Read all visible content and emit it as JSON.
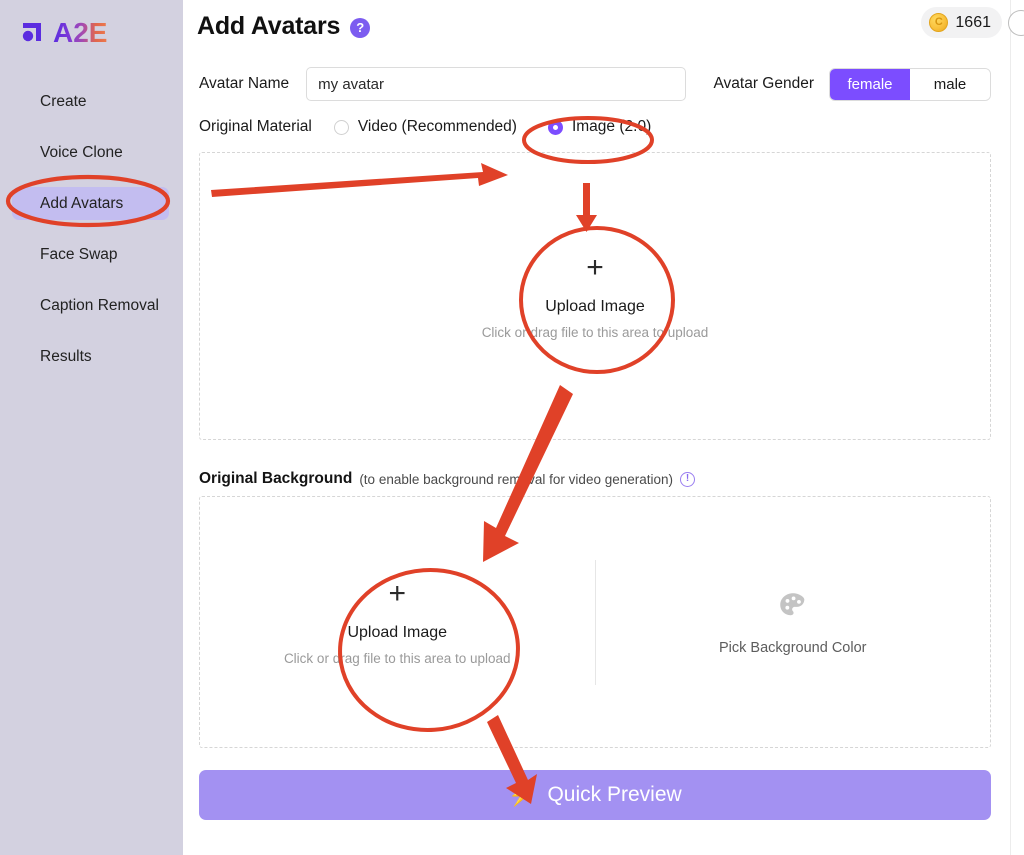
{
  "brand": {
    "logo_text": "A2E",
    "logo_icon": "a2e-mark-icon"
  },
  "sidebar": {
    "items": [
      {
        "label": "Create",
        "active": false
      },
      {
        "label": "Voice Clone",
        "active": false
      },
      {
        "label": "Add Avatars",
        "active": true
      },
      {
        "label": "Face Swap",
        "active": false
      },
      {
        "label": "Caption Removal",
        "active": false
      },
      {
        "label": "Results",
        "active": false
      }
    ]
  },
  "header": {
    "title": "Add Avatars",
    "help_badge": "?",
    "credits": "1661",
    "coin_glyph": "C"
  },
  "form": {
    "avatar_name_label": "Avatar Name",
    "avatar_name_value": "my avatar",
    "avatar_name_placeholder": "my avatar",
    "avatar_gender_label": "Avatar Gender",
    "gender_options": [
      {
        "label": "female",
        "selected": true
      },
      {
        "label": "male",
        "selected": false
      }
    ],
    "original_material_label": "Original Material",
    "material_options": [
      {
        "label": "Video (Recommended)",
        "selected": false
      },
      {
        "label": "Image (2.0)",
        "selected": true
      }
    ]
  },
  "upload_main": {
    "plus": "+",
    "title": "Upload Image",
    "subtitle": "Click or drag file to this area to upload"
  },
  "background_section": {
    "heading_strong": "Original Background",
    "heading_hint": "(to enable background removal for video generation)",
    "info_glyph": "!",
    "upload": {
      "plus": "+",
      "title": "Upload Image",
      "subtitle": "Click or drag file to this area to upload"
    },
    "picker_label": "Pick Background Color",
    "picker_icon": "palette-icon"
  },
  "actions": {
    "quick_preview_label": "Quick Preview",
    "quick_preview_icon": "lightning-bolt-icon"
  },
  "annotations": {
    "accent_color": "#e04128",
    "shapes": [
      "ellipse-around-sidebar-add-avatars",
      "ellipse-around-image-radio",
      "ellipse-around-main-upload",
      "ellipse-around-background-upload",
      "arrow-to-image-radio",
      "arrow-down-to-upload",
      "arrow-to-background-upload",
      "arrow-to-quick-preview"
    ]
  },
  "theme": {
    "sidebar_bg": "#d3d1e0",
    "sidebar_active_bg": "#c3bdf0",
    "primary": "#7c4dff",
    "quick_preview_bg": "#a391f2",
    "annotation_red": "#e04128"
  }
}
